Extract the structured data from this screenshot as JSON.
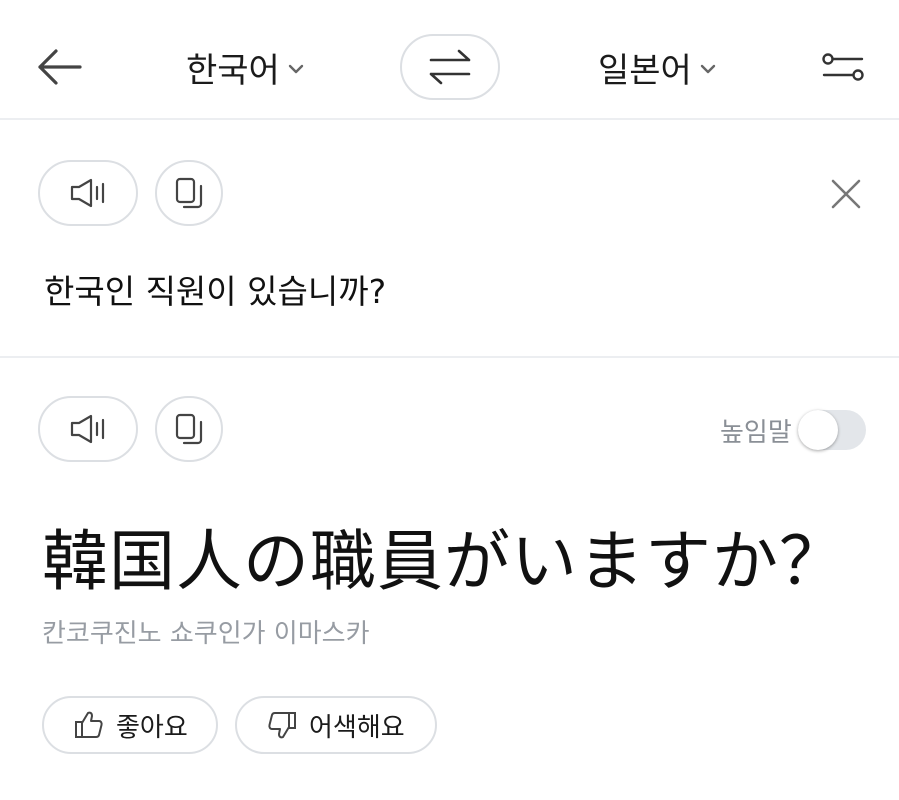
{
  "header": {
    "source_lang": "한국어",
    "target_lang": "일본어",
    "icons": {
      "back": "arrow-left-icon",
      "swap": "swap-arrows-icon",
      "settings": "settings-sliders-icon",
      "dropdown": "chevron-down-icon"
    }
  },
  "source": {
    "text": "한국인 직원이 있습니까?",
    "icons": {
      "speak": "speaker-icon",
      "copy": "copy-icon",
      "clear": "close-icon"
    }
  },
  "result": {
    "honorific_label": "높임말",
    "honorific_on": false,
    "text": "韓国人の職員がいますか？",
    "pronunciation": "칸코쿠진노 쇼쿠인가 이마스카",
    "icons": {
      "speak": "speaker-icon",
      "copy": "copy-icon"
    }
  },
  "feedback": {
    "good_label": "좋아요",
    "bad_label": "어색해요",
    "icons": {
      "good": "thumbs-up-icon",
      "bad": "thumbs-down-icon"
    }
  },
  "colors": {
    "text": "#1b1b1b",
    "muted": "#979ca3",
    "border": "#dcdfe3",
    "divider": "#eceef1",
    "toggle_off": "#e3e6ea"
  }
}
